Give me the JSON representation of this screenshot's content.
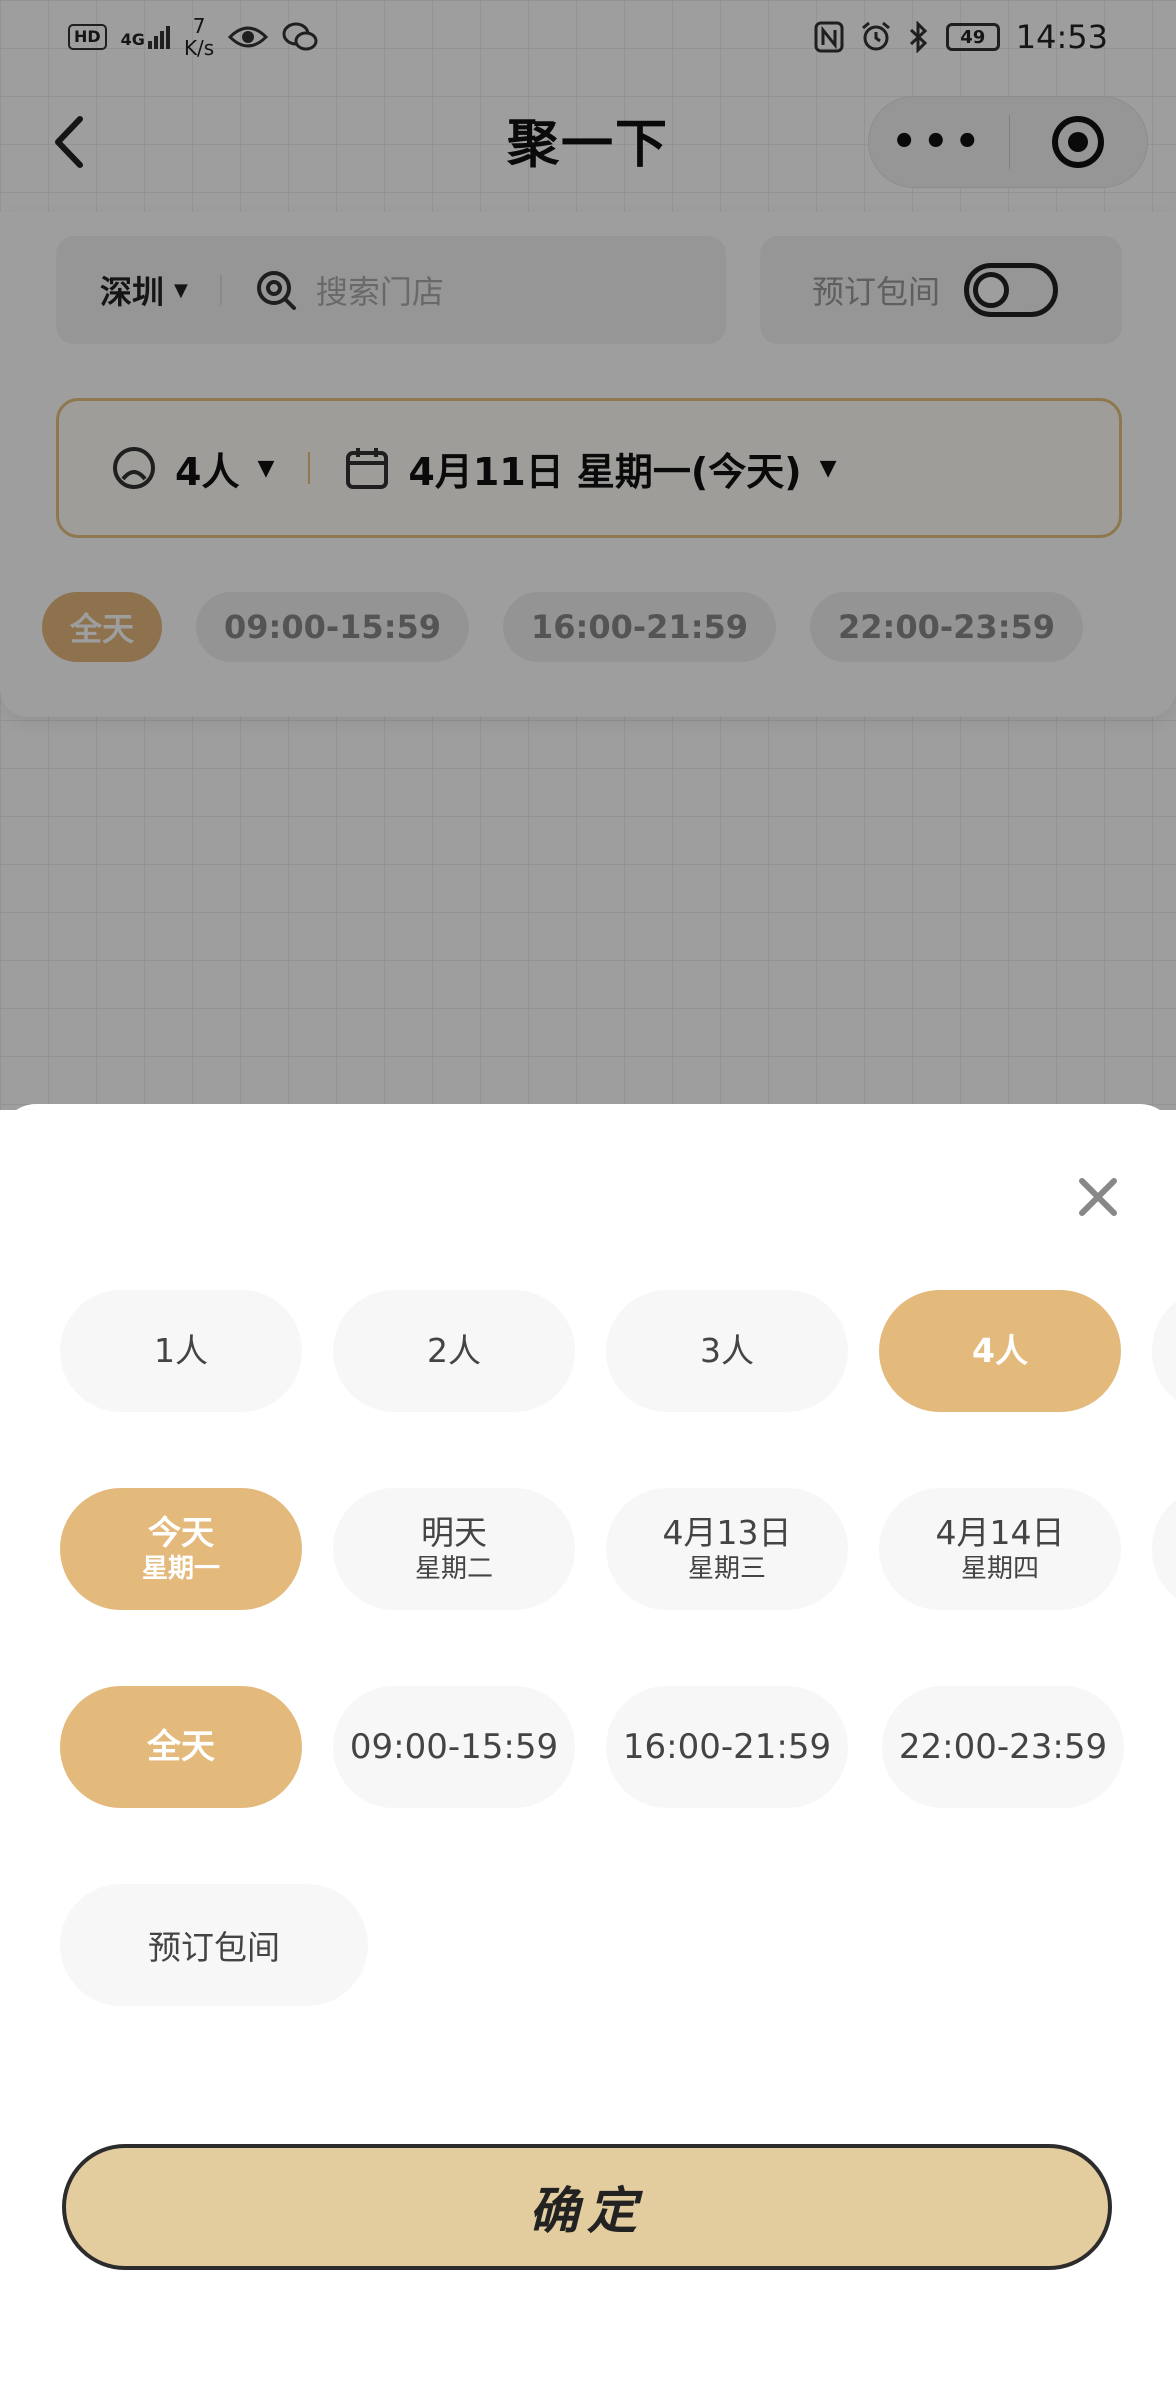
{
  "status_bar": {
    "hd": "HD",
    "network": "4G",
    "speed_value": "7",
    "speed_unit": "K/s",
    "battery": "49",
    "time": "14:53"
  },
  "nav": {
    "title": "聚一下"
  },
  "filter": {
    "city": "深圳",
    "search_placeholder": "搜索门店",
    "room_toggle_label": "预订包间",
    "people_value": "4人",
    "date_value": "4月11日 星期一(今天)",
    "time_chips": [
      {
        "label": "全天",
        "active": true
      },
      {
        "label": "09:00-15:59",
        "active": false
      },
      {
        "label": "16:00-21:59",
        "active": false
      },
      {
        "label": "22:00-23:59",
        "active": false
      }
    ]
  },
  "sheet": {
    "people": [
      {
        "label": "1人",
        "active": false
      },
      {
        "label": "2人",
        "active": false
      },
      {
        "label": "3人",
        "active": false
      },
      {
        "label": "4人",
        "active": true
      }
    ],
    "dates": [
      {
        "label": "今天",
        "sub": "星期一",
        "active": true
      },
      {
        "label": "明天",
        "sub": "星期二",
        "active": false
      },
      {
        "label": "4月13日",
        "sub": "星期三",
        "active": false
      },
      {
        "label": "4月14日",
        "sub": "星期四",
        "active": false
      }
    ],
    "times": [
      {
        "label": "全天",
        "active": true
      },
      {
        "label": "09:00-15:59",
        "active": false
      },
      {
        "label": "16:00-21:59",
        "active": false
      },
      {
        "label": "22:00-23:59",
        "active": false
      }
    ],
    "room_option": "预订包间",
    "confirm_label": "确定"
  },
  "colors": {
    "accent": "#e4b97c",
    "confirm_bg": "#e3cc9e",
    "chip_bg": "#f7f7f7",
    "overlay": "rgba(0,0,0,0.38)"
  }
}
